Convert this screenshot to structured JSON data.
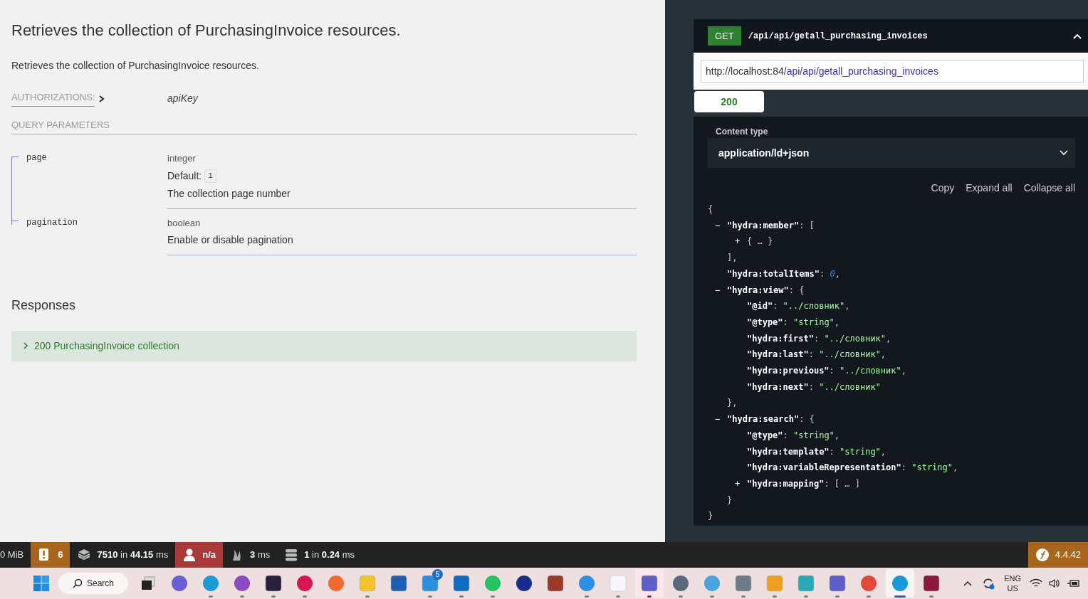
{
  "operation": {
    "title": "Retrieves the collection of PurchasingInvoice resources.",
    "description": "Retrieves the collection of PurchasingInvoice resources.",
    "authorizations_label": "AUTHORIZATIONS:",
    "authorization": "apiKey",
    "query_label": "QUERY PARAMETERS",
    "parameters": [
      {
        "name": "page",
        "type": "integer",
        "default_label": "Default:",
        "default": "1",
        "description": "The collection page number"
      },
      {
        "name": "pagination",
        "type": "boolean",
        "description": "Enable or disable pagination"
      }
    ],
    "responses_title": "Responses",
    "responses": [
      {
        "text": "200 PurchasingInvoice collection",
        "expanded": false
      }
    ]
  },
  "request": {
    "method": "GET",
    "path": "/api/api/getall_purchasing_invoices",
    "expanded": true,
    "url_host": "http://localhost:84",
    "url_path": "/api/api/getall_purchasing_invoices",
    "status_tabs": [
      {
        "label": "200",
        "selected": true
      }
    ],
    "content_type_label": "Content type",
    "content_type": "application/ld+json",
    "actions": [
      "Copy",
      "Expand all",
      "Collapse all"
    ],
    "body": {
      "open": "{",
      "close": "}",
      "children": [
        {
          "toggle": "−",
          "tokens": [
            {
              "kind": "key",
              "text": "\"hydra:member\""
            },
            {
              "kind": "punct",
              "text": ": ["
            }
          ],
          "close": "],",
          "children": [
            {
              "toggle": "+",
              "tokens": [
                {
                  "kind": "punct",
                  "text": "{ … }"
                }
              ]
            }
          ]
        },
        {
          "tokens": [
            {
              "kind": "key",
              "text": "\"hydra:totalItems\""
            },
            {
              "kind": "punct",
              "text": ": "
            },
            {
              "kind": "number",
              "text": "0"
            },
            {
              "kind": "punct",
              "text": ","
            }
          ]
        },
        {
          "toggle": "−",
          "tokens": [
            {
              "kind": "key",
              "text": "\"hydra:view\""
            },
            {
              "kind": "punct",
              "text": ": {"
            }
          ],
          "close": "},",
          "children": [
            {
              "tokens": [
                {
                  "kind": "key",
                  "text": "\"@id\""
                },
                {
                  "kind": "punct",
                  "text": ": "
                },
                {
                  "kind": "string",
                  "text": "\"../словник\""
                },
                {
                  "kind": "punct",
                  "text": ","
                }
              ]
            },
            {
              "tokens": [
                {
                  "kind": "key",
                  "text": "\"@type\""
                },
                {
                  "kind": "punct",
                  "text": ": "
                },
                {
                  "kind": "string",
                  "text": "\"string\""
                },
                {
                  "kind": "punct",
                  "text": ","
                }
              ]
            },
            {
              "tokens": [
                {
                  "kind": "key",
                  "text": "\"hydra:first\""
                },
                {
                  "kind": "punct",
                  "text": ": "
                },
                {
                  "kind": "string",
                  "text": "\"../словник\""
                },
                {
                  "kind": "punct",
                  "text": ","
                }
              ]
            },
            {
              "tokens": [
                {
                  "kind": "key",
                  "text": "\"hydra:last\""
                },
                {
                  "kind": "punct",
                  "text": ": "
                },
                {
                  "kind": "string",
                  "text": "\"../словник\""
                },
                {
                  "kind": "punct",
                  "text": ","
                }
              ]
            },
            {
              "tokens": [
                {
                  "kind": "key",
                  "text": "\"hydra:previous\""
                },
                {
                  "kind": "punct",
                  "text": ": "
                },
                {
                  "kind": "string",
                  "text": "\"../словник\""
                },
                {
                  "kind": "punct",
                  "text": ","
                }
              ]
            },
            {
              "tokens": [
                {
                  "kind": "key",
                  "text": "\"hydra:next\""
                },
                {
                  "kind": "punct",
                  "text": ": "
                },
                {
                  "kind": "string",
                  "text": "\"../словник\""
                }
              ]
            }
          ]
        },
        {
          "toggle": "−",
          "tokens": [
            {
              "kind": "key",
              "text": "\"hydra:search\""
            },
            {
              "kind": "punct",
              "text": ": {"
            }
          ],
          "close": "}",
          "children": [
            {
              "tokens": [
                {
                  "kind": "key",
                  "text": "\"@type\""
                },
                {
                  "kind": "punct",
                  "text": ": "
                },
                {
                  "kind": "string",
                  "text": "\"string\""
                },
                {
                  "kind": "punct",
                  "text": ","
                }
              ]
            },
            {
              "tokens": [
                {
                  "kind": "key",
                  "text": "\"hydra:template\""
                },
                {
                  "kind": "punct",
                  "text": ": "
                },
                {
                  "kind": "string",
                  "text": "\"string\""
                },
                {
                  "kind": "punct",
                  "text": ","
                }
              ]
            },
            {
              "tokens": [
                {
                  "kind": "key",
                  "text": "\"hydra:variableRepresentation\""
                },
                {
                  "kind": "punct",
                  "text": ": "
                },
                {
                  "kind": "string",
                  "text": "\"string\""
                },
                {
                  "kind": "punct",
                  "text": ","
                }
              ]
            },
            {
              "toggle": "+",
              "tokens": [
                {
                  "kind": "key",
                  "text": "\"hydra:mapping\""
                },
                {
                  "kind": "punct",
                  "text": ": [ … ]"
                }
              ]
            }
          ]
        }
      ]
    }
  },
  "debug_toolbar": {
    "items": [
      {
        "kind": "memory",
        "text": "0 MiB"
      },
      {
        "kind": "logs",
        "text": "**6**",
        "color": "#a8651e"
      },
      {
        "kind": "queries",
        "text": "**7510** in **44.15** ms"
      },
      {
        "kind": "user",
        "text": "**n/a**",
        "color": "#a93a3a"
      },
      {
        "kind": "time",
        "text": "**3** ms"
      },
      {
        "kind": "db",
        "text": "**1** in **0.24** ms"
      }
    ],
    "version": "4.4.42"
  },
  "taskbar": {
    "search": "Search",
    "apps": [
      {
        "kind": "circle",
        "color": "#6b5fd6",
        "running": false,
        "selected": false
      },
      {
        "kind": "circle",
        "color": "#1a9ad6",
        "running": true,
        "selected": false
      },
      {
        "kind": "circle",
        "color": "#8a4cc0",
        "running": true,
        "selected": false
      },
      {
        "kind": "tile",
        "color": "#2a1f3d",
        "running": true,
        "selected": false
      },
      {
        "kind": "circle",
        "color": "#d7174f",
        "running": true,
        "selected": false
      },
      {
        "kind": "circle",
        "color": "#f26a2e",
        "running": false,
        "selected": false
      },
      {
        "kind": "tile",
        "color": "#f3c233",
        "running": true,
        "selected": false
      },
      {
        "kind": "tile",
        "color": "#1f5fb3",
        "running": false,
        "selected": false
      },
      {
        "kind": "tile",
        "color": "#2a8fe0",
        "running": true,
        "selected": false,
        "badge": "5"
      },
      {
        "kind": "tile",
        "color": "#0f6cc4",
        "running": true,
        "selected": false
      },
      {
        "kind": "circle",
        "color": "#25c364",
        "running": true,
        "selected": false
      },
      {
        "kind": "circle",
        "color": "#1b2d8a",
        "running": false,
        "selected": false
      },
      {
        "kind": "tile",
        "color": "#9b3a2a",
        "running": false,
        "selected": false
      },
      {
        "kind": "circle",
        "color": "#2d8fe6",
        "running": true,
        "selected": false
      },
      {
        "kind": "tile",
        "color": "#f7f7fb",
        "running": true,
        "selected": false
      },
      {
        "kind": "tile",
        "color": "#5b5fc7",
        "running": true,
        "selected": false,
        "attention": true
      },
      {
        "kind": "circle",
        "color": "#5a6a7a",
        "running": true,
        "selected": false
      },
      {
        "kind": "circle",
        "color": "#4aa3df",
        "running": true,
        "selected": false
      },
      {
        "kind": "tile",
        "color": "#6d7b86",
        "running": true,
        "selected": false
      },
      {
        "kind": "tile",
        "color": "#f0a020",
        "running": true,
        "selected": false
      },
      {
        "kind": "tile",
        "color": "#2aa7b8",
        "running": true,
        "selected": false
      },
      {
        "kind": "tile",
        "color": "#5b5fc7",
        "running": true,
        "selected": false
      },
      {
        "kind": "circle",
        "color": "#e24a3a",
        "running": true,
        "selected": false
      },
      {
        "kind": "circle",
        "color": "#1a9ad6",
        "running": true,
        "selected": true
      },
      {
        "kind": "tile",
        "color": "#8b1a3a",
        "running": true,
        "selected": false
      }
    ],
    "language": "ENG",
    "region": "US"
  }
}
